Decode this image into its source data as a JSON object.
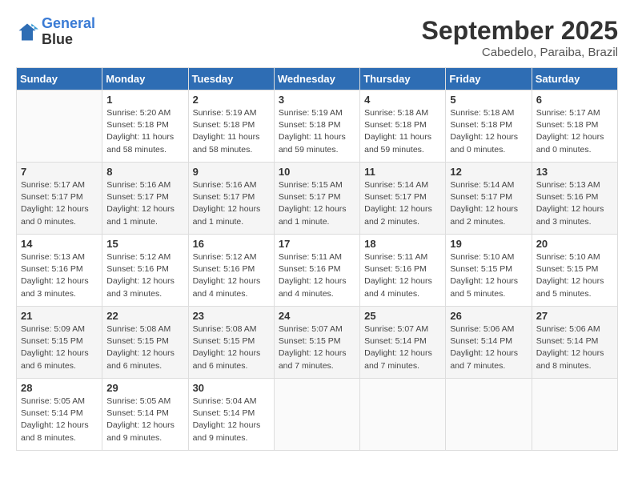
{
  "header": {
    "logo_line1": "General",
    "logo_line2": "Blue",
    "month": "September 2025",
    "location": "Cabedelo, Paraiba, Brazil"
  },
  "weekdays": [
    "Sunday",
    "Monday",
    "Tuesday",
    "Wednesday",
    "Thursday",
    "Friday",
    "Saturday"
  ],
  "weeks": [
    [
      {
        "day": "",
        "info": ""
      },
      {
        "day": "1",
        "info": "Sunrise: 5:20 AM\nSunset: 5:18 PM\nDaylight: 11 hours\nand 58 minutes."
      },
      {
        "day": "2",
        "info": "Sunrise: 5:19 AM\nSunset: 5:18 PM\nDaylight: 11 hours\nand 58 minutes."
      },
      {
        "day": "3",
        "info": "Sunrise: 5:19 AM\nSunset: 5:18 PM\nDaylight: 11 hours\nand 59 minutes."
      },
      {
        "day": "4",
        "info": "Sunrise: 5:18 AM\nSunset: 5:18 PM\nDaylight: 11 hours\nand 59 minutes."
      },
      {
        "day": "5",
        "info": "Sunrise: 5:18 AM\nSunset: 5:18 PM\nDaylight: 12 hours\nand 0 minutes."
      },
      {
        "day": "6",
        "info": "Sunrise: 5:17 AM\nSunset: 5:18 PM\nDaylight: 12 hours\nand 0 minutes."
      }
    ],
    [
      {
        "day": "7",
        "info": "Sunrise: 5:17 AM\nSunset: 5:17 PM\nDaylight: 12 hours\nand 0 minutes."
      },
      {
        "day": "8",
        "info": "Sunrise: 5:16 AM\nSunset: 5:17 PM\nDaylight: 12 hours\nand 1 minute."
      },
      {
        "day": "9",
        "info": "Sunrise: 5:16 AM\nSunset: 5:17 PM\nDaylight: 12 hours\nand 1 minute."
      },
      {
        "day": "10",
        "info": "Sunrise: 5:15 AM\nSunset: 5:17 PM\nDaylight: 12 hours\nand 1 minute."
      },
      {
        "day": "11",
        "info": "Sunrise: 5:14 AM\nSunset: 5:17 PM\nDaylight: 12 hours\nand 2 minutes."
      },
      {
        "day": "12",
        "info": "Sunrise: 5:14 AM\nSunset: 5:17 PM\nDaylight: 12 hours\nand 2 minutes."
      },
      {
        "day": "13",
        "info": "Sunrise: 5:13 AM\nSunset: 5:16 PM\nDaylight: 12 hours\nand 3 minutes."
      }
    ],
    [
      {
        "day": "14",
        "info": "Sunrise: 5:13 AM\nSunset: 5:16 PM\nDaylight: 12 hours\nand 3 minutes."
      },
      {
        "day": "15",
        "info": "Sunrise: 5:12 AM\nSunset: 5:16 PM\nDaylight: 12 hours\nand 3 minutes."
      },
      {
        "day": "16",
        "info": "Sunrise: 5:12 AM\nSunset: 5:16 PM\nDaylight: 12 hours\nand 4 minutes."
      },
      {
        "day": "17",
        "info": "Sunrise: 5:11 AM\nSunset: 5:16 PM\nDaylight: 12 hours\nand 4 minutes."
      },
      {
        "day": "18",
        "info": "Sunrise: 5:11 AM\nSunset: 5:16 PM\nDaylight: 12 hours\nand 4 minutes."
      },
      {
        "day": "19",
        "info": "Sunrise: 5:10 AM\nSunset: 5:15 PM\nDaylight: 12 hours\nand 5 minutes."
      },
      {
        "day": "20",
        "info": "Sunrise: 5:10 AM\nSunset: 5:15 PM\nDaylight: 12 hours\nand 5 minutes."
      }
    ],
    [
      {
        "day": "21",
        "info": "Sunrise: 5:09 AM\nSunset: 5:15 PM\nDaylight: 12 hours\nand 6 minutes."
      },
      {
        "day": "22",
        "info": "Sunrise: 5:08 AM\nSunset: 5:15 PM\nDaylight: 12 hours\nand 6 minutes."
      },
      {
        "day": "23",
        "info": "Sunrise: 5:08 AM\nSunset: 5:15 PM\nDaylight: 12 hours\nand 6 minutes."
      },
      {
        "day": "24",
        "info": "Sunrise: 5:07 AM\nSunset: 5:15 PM\nDaylight: 12 hours\nand 7 minutes."
      },
      {
        "day": "25",
        "info": "Sunrise: 5:07 AM\nSunset: 5:14 PM\nDaylight: 12 hours\nand 7 minutes."
      },
      {
        "day": "26",
        "info": "Sunrise: 5:06 AM\nSunset: 5:14 PM\nDaylight: 12 hours\nand 7 minutes."
      },
      {
        "day": "27",
        "info": "Sunrise: 5:06 AM\nSunset: 5:14 PM\nDaylight: 12 hours\nand 8 minutes."
      }
    ],
    [
      {
        "day": "28",
        "info": "Sunrise: 5:05 AM\nSunset: 5:14 PM\nDaylight: 12 hours\nand 8 minutes."
      },
      {
        "day": "29",
        "info": "Sunrise: 5:05 AM\nSunset: 5:14 PM\nDaylight: 12 hours\nand 9 minutes."
      },
      {
        "day": "30",
        "info": "Sunrise: 5:04 AM\nSunset: 5:14 PM\nDaylight: 12 hours\nand 9 minutes."
      },
      {
        "day": "",
        "info": ""
      },
      {
        "day": "",
        "info": ""
      },
      {
        "day": "",
        "info": ""
      },
      {
        "day": "",
        "info": ""
      }
    ]
  ]
}
